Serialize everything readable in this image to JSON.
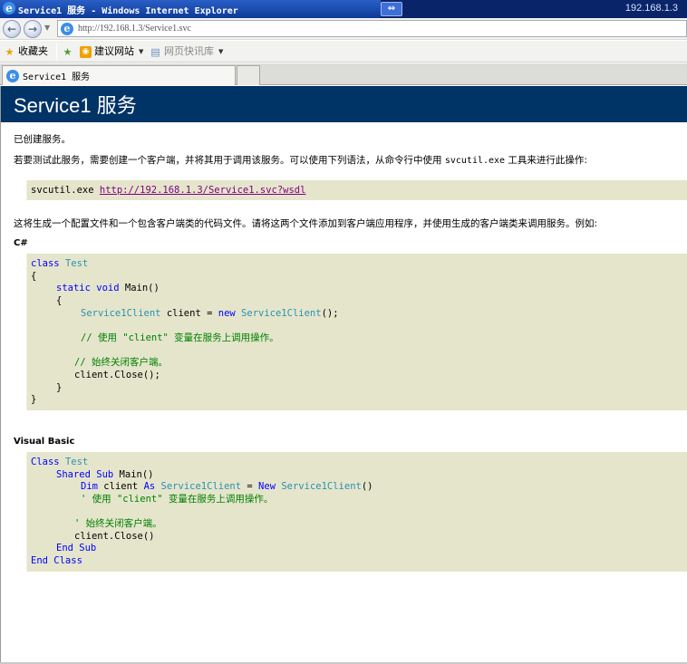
{
  "window": {
    "title": "Service1 服务 - Windows Internet Explorer",
    "host_label": "192.168.1.3"
  },
  "address_bar": {
    "url": "http://192.168.1.3/Service1.svc"
  },
  "favorites_bar": {
    "favorites_label": "收藏夹",
    "suggested_sites_label": "建议网站",
    "web_slice_label": "网页快讯库"
  },
  "tab": {
    "label": "Service1 服务"
  },
  "page": {
    "heading": "Service1 服务",
    "created_text": "已创建服务。",
    "instruction_prefix": "若要测试此服务，需要创建一个客户端，并将其用于调用该服务。可以使用下列语法，从命令行中使用",
    "instruction_tool": "svcutil.exe",
    "instruction_suffix": "工具来进行此操作:",
    "svcutil_command": "svcutil.exe",
    "wsdl_link": "http://192.168.1.3/Service1.svc?wsdl",
    "generate_text": "这将生成一个配置文件和一个包含客户端类的代码文件。请将这两个文件添加到客户端应用程序，并使用生成的客户端类来调用服务。例如:",
    "csharp_label": "C#",
    "vb_label": "Visual Basic"
  },
  "csharp_code": {
    "l1_kw": "class",
    "l1_type": "Test",
    "l2": "{",
    "l3_kw": "static void",
    "l3_rest": "Main()",
    "l4": "{",
    "l5_type1": "Service1Client",
    "l5_mid": "client =",
    "l5_kw": "new",
    "l5_type2": "Service1Client",
    "l5_end": "();",
    "l6_comment": "// 使用 \"client\" 变量在服务上调用操作。",
    "l7_comment": "// 始终关闭客户端。",
    "l8": "client.Close();",
    "l9": "}",
    "l10": "}"
  },
  "vb_code": {
    "l1_kw": "Class",
    "l1_type": "Test",
    "l2_kw": "Shared Sub",
    "l2_rest": "Main()",
    "l3_kw1": "Dim",
    "l3_mid": "client",
    "l3_kw2": "As",
    "l3_type1": "Service1Client",
    "l3_eq": "=",
    "l3_kw3": "New",
    "l3_type2": "Service1Client",
    "l3_end": "()",
    "l4_comment": "' 使用 \"client\" 变量在服务上调用操作。",
    "l5_comment": "' 始终关闭客户端。",
    "l6": "client.Close()",
    "l7_kw": "End Sub",
    "l8_kw": "End Class"
  },
  "colors": {
    "heading_bg": "#003366",
    "code_bg": "#e5e5cc",
    "keyword": "#0000ff",
    "type": "#2b91af",
    "comment": "#008000",
    "link": "#800080"
  },
  "icons": [
    "ie-logo-icon",
    "back-icon",
    "forward-icon",
    "page-icon",
    "favorites-star-icon",
    "add-favorite-icon",
    "suggested-sites-icon",
    "web-slice-icon",
    "tab-page-icon"
  ]
}
